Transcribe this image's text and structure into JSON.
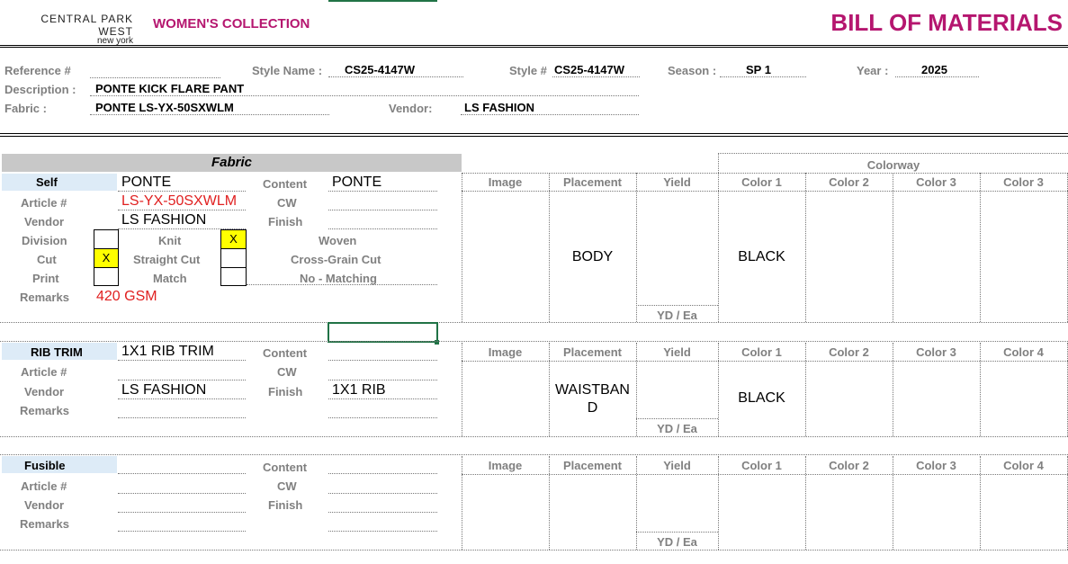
{
  "header": {
    "brand_line1": "CENTRAL PARK WEST",
    "brand_line2": "new york",
    "collection": "WOMEN'S COLLECTION",
    "title": "BILL OF MATERIALS"
  },
  "info": {
    "reference_label": "Reference #",
    "reference_value": "",
    "style_name_label": "Style Name :",
    "style_name_value": "CS25-4147W",
    "style_num_label": "Style #",
    "style_num_value": "CS25-4147W",
    "season_label": "Season :",
    "season_value": "SP 1",
    "year_label": "Year :",
    "year_value": "2025",
    "description_label": "Description :",
    "description_value": "PONTE KICK FLARE PANT",
    "fabric_label": "Fabric :",
    "fabric_value": "PONTE LS-YX-50SXWLM",
    "vendor_label": "Vendor:",
    "vendor_value": "LS FASHION"
  },
  "fabric_header": "Fabric",
  "colorway_header": "Colorway",
  "section1": {
    "name": "Self",
    "name_value": "PONTE",
    "article_label": "Article #",
    "article_value": "LS-YX-50SXWLM",
    "vendor_label": "Vendor",
    "vendor_value": "LS FASHION",
    "division_label": "Division",
    "knit_label": "Knit",
    "woven_label": "Woven",
    "woven_mark": "X",
    "cut_label": "Cut",
    "cut_mark": "X",
    "straight_cut_label": "Straight Cut",
    "cross_grain_label": "Cross-Grain Cut",
    "print_label": "Print",
    "match_label": "Match",
    "no_matching_label": "No - Matching",
    "remarks_label": "Remarks",
    "remarks_value": "420 GSM",
    "content_label": "Content",
    "content_value": "PONTE",
    "cw_label": "CW",
    "finish_label": "Finish",
    "cols": [
      "Image",
      "Placement",
      "Yield",
      "Color 1",
      "Color 2",
      "Color 3",
      "Color 3"
    ],
    "placement_value": "BODY",
    "color1_value": "BLACK",
    "yield_unit": "YD / Ea"
  },
  "section2": {
    "name": "RIB TRIM",
    "name_value": "1X1 RIB TRIM",
    "article_label": "Article #",
    "vendor_label": "Vendor",
    "vendor_value": "LS FASHION",
    "remarks_label": "Remarks",
    "content_label": "Content",
    "cw_label": "CW",
    "finish_label": "Finish",
    "finish_value": "1X1 RIB",
    "cols": [
      "Image",
      "Placement",
      "Yield",
      "Color 1",
      "Color 2",
      "Color 3",
      "Color 4"
    ],
    "placement_line1": "WAISTBAN",
    "placement_line2": "D",
    "color1_value": "BLACK",
    "yield_unit": "YD / Ea"
  },
  "section3": {
    "name": "Fusible",
    "article_label": "Article #",
    "vendor_label": "Vendor",
    "remarks_label": "Remarks",
    "content_label": "Content",
    "cw_label": "CW",
    "finish_label": "Finish",
    "cols": [
      "Image",
      "Placement",
      "Yield",
      "Color 1",
      "Color 2",
      "Color 3",
      "Color 4"
    ],
    "yield_unit": "YD / Ea"
  },
  "colors": {
    "accent": "#b5166f",
    "fabric_bar": "#c8c8c8",
    "label_bg": "#ddebf7",
    "highlight": "#ffff00",
    "selection": "#217346"
  }
}
